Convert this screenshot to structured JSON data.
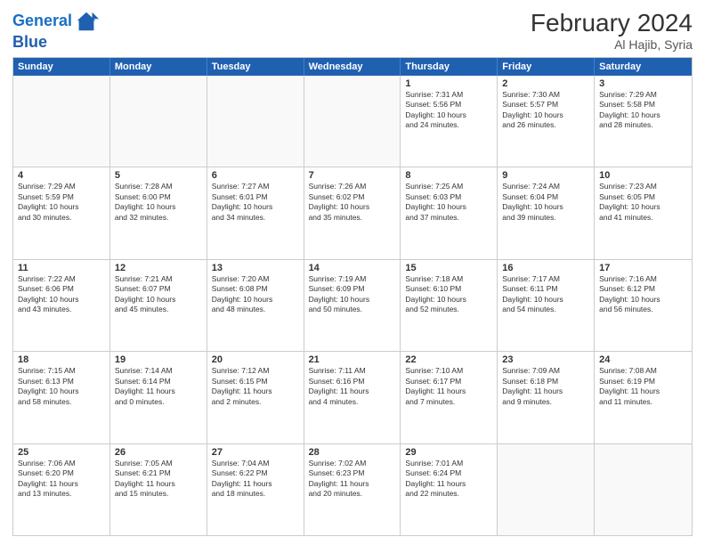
{
  "header": {
    "logo_line1": "General",
    "logo_line2": "Blue",
    "title": "February 2024",
    "subtitle": "Al Hajib, Syria"
  },
  "days_of_week": [
    "Sunday",
    "Monday",
    "Tuesday",
    "Wednesday",
    "Thursday",
    "Friday",
    "Saturday"
  ],
  "weeks": [
    [
      {
        "day": "",
        "info": ""
      },
      {
        "day": "",
        "info": ""
      },
      {
        "day": "",
        "info": ""
      },
      {
        "day": "",
        "info": ""
      },
      {
        "day": "1",
        "info": "Sunrise: 7:31 AM\nSunset: 5:56 PM\nDaylight: 10 hours\nand 24 minutes."
      },
      {
        "day": "2",
        "info": "Sunrise: 7:30 AM\nSunset: 5:57 PM\nDaylight: 10 hours\nand 26 minutes."
      },
      {
        "day": "3",
        "info": "Sunrise: 7:29 AM\nSunset: 5:58 PM\nDaylight: 10 hours\nand 28 minutes."
      }
    ],
    [
      {
        "day": "4",
        "info": "Sunrise: 7:29 AM\nSunset: 5:59 PM\nDaylight: 10 hours\nand 30 minutes."
      },
      {
        "day": "5",
        "info": "Sunrise: 7:28 AM\nSunset: 6:00 PM\nDaylight: 10 hours\nand 32 minutes."
      },
      {
        "day": "6",
        "info": "Sunrise: 7:27 AM\nSunset: 6:01 PM\nDaylight: 10 hours\nand 34 minutes."
      },
      {
        "day": "7",
        "info": "Sunrise: 7:26 AM\nSunset: 6:02 PM\nDaylight: 10 hours\nand 35 minutes."
      },
      {
        "day": "8",
        "info": "Sunrise: 7:25 AM\nSunset: 6:03 PM\nDaylight: 10 hours\nand 37 minutes."
      },
      {
        "day": "9",
        "info": "Sunrise: 7:24 AM\nSunset: 6:04 PM\nDaylight: 10 hours\nand 39 minutes."
      },
      {
        "day": "10",
        "info": "Sunrise: 7:23 AM\nSunset: 6:05 PM\nDaylight: 10 hours\nand 41 minutes."
      }
    ],
    [
      {
        "day": "11",
        "info": "Sunrise: 7:22 AM\nSunset: 6:06 PM\nDaylight: 10 hours\nand 43 minutes."
      },
      {
        "day": "12",
        "info": "Sunrise: 7:21 AM\nSunset: 6:07 PM\nDaylight: 10 hours\nand 45 minutes."
      },
      {
        "day": "13",
        "info": "Sunrise: 7:20 AM\nSunset: 6:08 PM\nDaylight: 10 hours\nand 48 minutes."
      },
      {
        "day": "14",
        "info": "Sunrise: 7:19 AM\nSunset: 6:09 PM\nDaylight: 10 hours\nand 50 minutes."
      },
      {
        "day": "15",
        "info": "Sunrise: 7:18 AM\nSunset: 6:10 PM\nDaylight: 10 hours\nand 52 minutes."
      },
      {
        "day": "16",
        "info": "Sunrise: 7:17 AM\nSunset: 6:11 PM\nDaylight: 10 hours\nand 54 minutes."
      },
      {
        "day": "17",
        "info": "Sunrise: 7:16 AM\nSunset: 6:12 PM\nDaylight: 10 hours\nand 56 minutes."
      }
    ],
    [
      {
        "day": "18",
        "info": "Sunrise: 7:15 AM\nSunset: 6:13 PM\nDaylight: 10 hours\nand 58 minutes."
      },
      {
        "day": "19",
        "info": "Sunrise: 7:14 AM\nSunset: 6:14 PM\nDaylight: 11 hours\nand 0 minutes."
      },
      {
        "day": "20",
        "info": "Sunrise: 7:12 AM\nSunset: 6:15 PM\nDaylight: 11 hours\nand 2 minutes."
      },
      {
        "day": "21",
        "info": "Sunrise: 7:11 AM\nSunset: 6:16 PM\nDaylight: 11 hours\nand 4 minutes."
      },
      {
        "day": "22",
        "info": "Sunrise: 7:10 AM\nSunset: 6:17 PM\nDaylight: 11 hours\nand 7 minutes."
      },
      {
        "day": "23",
        "info": "Sunrise: 7:09 AM\nSunset: 6:18 PM\nDaylight: 11 hours\nand 9 minutes."
      },
      {
        "day": "24",
        "info": "Sunrise: 7:08 AM\nSunset: 6:19 PM\nDaylight: 11 hours\nand 11 minutes."
      }
    ],
    [
      {
        "day": "25",
        "info": "Sunrise: 7:06 AM\nSunset: 6:20 PM\nDaylight: 11 hours\nand 13 minutes."
      },
      {
        "day": "26",
        "info": "Sunrise: 7:05 AM\nSunset: 6:21 PM\nDaylight: 11 hours\nand 15 minutes."
      },
      {
        "day": "27",
        "info": "Sunrise: 7:04 AM\nSunset: 6:22 PM\nDaylight: 11 hours\nand 18 minutes."
      },
      {
        "day": "28",
        "info": "Sunrise: 7:02 AM\nSunset: 6:23 PM\nDaylight: 11 hours\nand 20 minutes."
      },
      {
        "day": "29",
        "info": "Sunrise: 7:01 AM\nSunset: 6:24 PM\nDaylight: 11 hours\nand 22 minutes."
      },
      {
        "day": "",
        "info": ""
      },
      {
        "day": "",
        "info": ""
      }
    ]
  ]
}
